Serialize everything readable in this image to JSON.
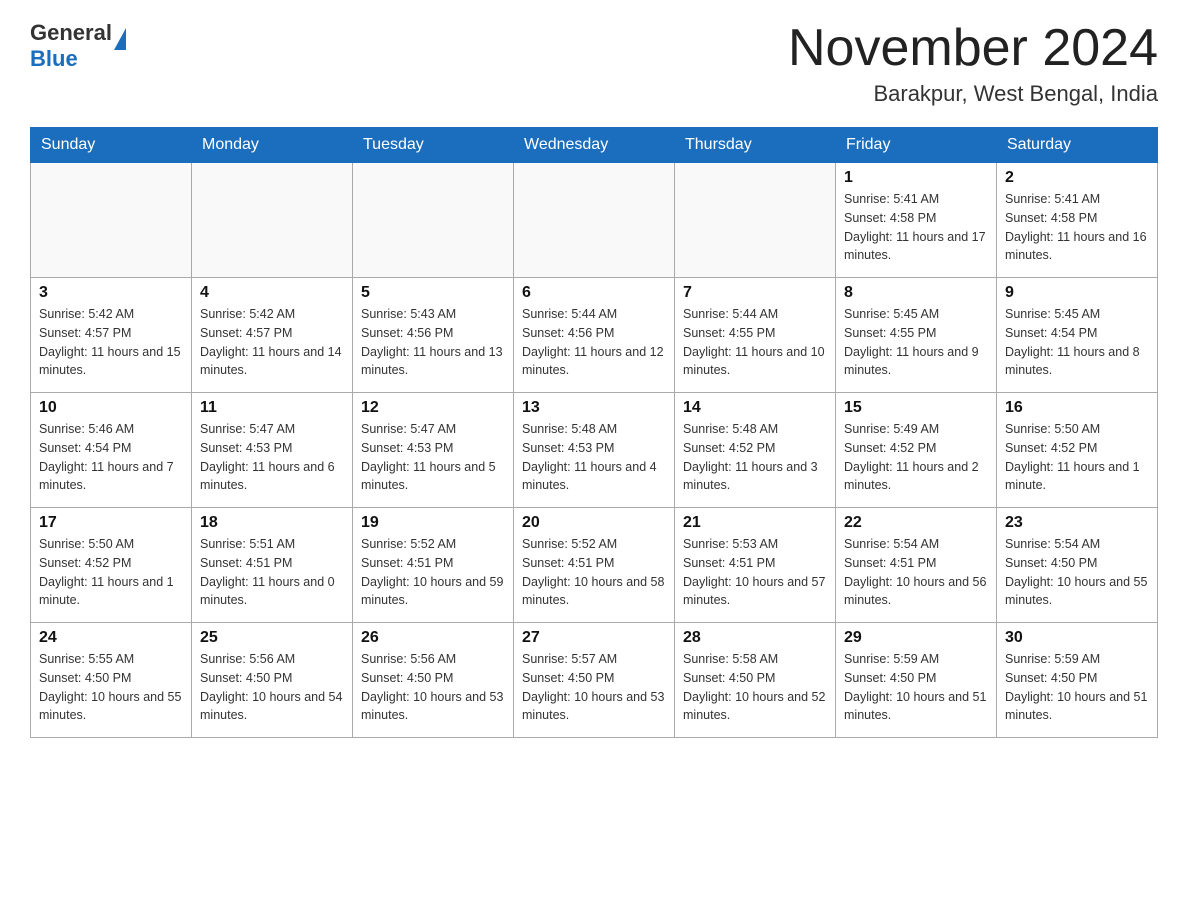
{
  "header": {
    "logo_general": "General",
    "logo_blue": "Blue",
    "month_title": "November 2024",
    "location": "Barakpur, West Bengal, India"
  },
  "days_of_week": [
    "Sunday",
    "Monday",
    "Tuesday",
    "Wednesday",
    "Thursday",
    "Friday",
    "Saturday"
  ],
  "weeks": [
    [
      {
        "day": "",
        "info": ""
      },
      {
        "day": "",
        "info": ""
      },
      {
        "day": "",
        "info": ""
      },
      {
        "day": "",
        "info": ""
      },
      {
        "day": "",
        "info": ""
      },
      {
        "day": "1",
        "info": "Sunrise: 5:41 AM\nSunset: 4:58 PM\nDaylight: 11 hours and 17 minutes."
      },
      {
        "day": "2",
        "info": "Sunrise: 5:41 AM\nSunset: 4:58 PM\nDaylight: 11 hours and 16 minutes."
      }
    ],
    [
      {
        "day": "3",
        "info": "Sunrise: 5:42 AM\nSunset: 4:57 PM\nDaylight: 11 hours and 15 minutes."
      },
      {
        "day": "4",
        "info": "Sunrise: 5:42 AM\nSunset: 4:57 PM\nDaylight: 11 hours and 14 minutes."
      },
      {
        "day": "5",
        "info": "Sunrise: 5:43 AM\nSunset: 4:56 PM\nDaylight: 11 hours and 13 minutes."
      },
      {
        "day": "6",
        "info": "Sunrise: 5:44 AM\nSunset: 4:56 PM\nDaylight: 11 hours and 12 minutes."
      },
      {
        "day": "7",
        "info": "Sunrise: 5:44 AM\nSunset: 4:55 PM\nDaylight: 11 hours and 10 minutes."
      },
      {
        "day": "8",
        "info": "Sunrise: 5:45 AM\nSunset: 4:55 PM\nDaylight: 11 hours and 9 minutes."
      },
      {
        "day": "9",
        "info": "Sunrise: 5:45 AM\nSunset: 4:54 PM\nDaylight: 11 hours and 8 minutes."
      }
    ],
    [
      {
        "day": "10",
        "info": "Sunrise: 5:46 AM\nSunset: 4:54 PM\nDaylight: 11 hours and 7 minutes."
      },
      {
        "day": "11",
        "info": "Sunrise: 5:47 AM\nSunset: 4:53 PM\nDaylight: 11 hours and 6 minutes."
      },
      {
        "day": "12",
        "info": "Sunrise: 5:47 AM\nSunset: 4:53 PM\nDaylight: 11 hours and 5 minutes."
      },
      {
        "day": "13",
        "info": "Sunrise: 5:48 AM\nSunset: 4:53 PM\nDaylight: 11 hours and 4 minutes."
      },
      {
        "day": "14",
        "info": "Sunrise: 5:48 AM\nSunset: 4:52 PM\nDaylight: 11 hours and 3 minutes."
      },
      {
        "day": "15",
        "info": "Sunrise: 5:49 AM\nSunset: 4:52 PM\nDaylight: 11 hours and 2 minutes."
      },
      {
        "day": "16",
        "info": "Sunrise: 5:50 AM\nSunset: 4:52 PM\nDaylight: 11 hours and 1 minute."
      }
    ],
    [
      {
        "day": "17",
        "info": "Sunrise: 5:50 AM\nSunset: 4:52 PM\nDaylight: 11 hours and 1 minute."
      },
      {
        "day": "18",
        "info": "Sunrise: 5:51 AM\nSunset: 4:51 PM\nDaylight: 11 hours and 0 minutes."
      },
      {
        "day": "19",
        "info": "Sunrise: 5:52 AM\nSunset: 4:51 PM\nDaylight: 10 hours and 59 minutes."
      },
      {
        "day": "20",
        "info": "Sunrise: 5:52 AM\nSunset: 4:51 PM\nDaylight: 10 hours and 58 minutes."
      },
      {
        "day": "21",
        "info": "Sunrise: 5:53 AM\nSunset: 4:51 PM\nDaylight: 10 hours and 57 minutes."
      },
      {
        "day": "22",
        "info": "Sunrise: 5:54 AM\nSunset: 4:51 PM\nDaylight: 10 hours and 56 minutes."
      },
      {
        "day": "23",
        "info": "Sunrise: 5:54 AM\nSunset: 4:50 PM\nDaylight: 10 hours and 55 minutes."
      }
    ],
    [
      {
        "day": "24",
        "info": "Sunrise: 5:55 AM\nSunset: 4:50 PM\nDaylight: 10 hours and 55 minutes."
      },
      {
        "day": "25",
        "info": "Sunrise: 5:56 AM\nSunset: 4:50 PM\nDaylight: 10 hours and 54 minutes."
      },
      {
        "day": "26",
        "info": "Sunrise: 5:56 AM\nSunset: 4:50 PM\nDaylight: 10 hours and 53 minutes."
      },
      {
        "day": "27",
        "info": "Sunrise: 5:57 AM\nSunset: 4:50 PM\nDaylight: 10 hours and 53 minutes."
      },
      {
        "day": "28",
        "info": "Sunrise: 5:58 AM\nSunset: 4:50 PM\nDaylight: 10 hours and 52 minutes."
      },
      {
        "day": "29",
        "info": "Sunrise: 5:59 AM\nSunset: 4:50 PM\nDaylight: 10 hours and 51 minutes."
      },
      {
        "day": "30",
        "info": "Sunrise: 5:59 AM\nSunset: 4:50 PM\nDaylight: 10 hours and 51 minutes."
      }
    ]
  ]
}
